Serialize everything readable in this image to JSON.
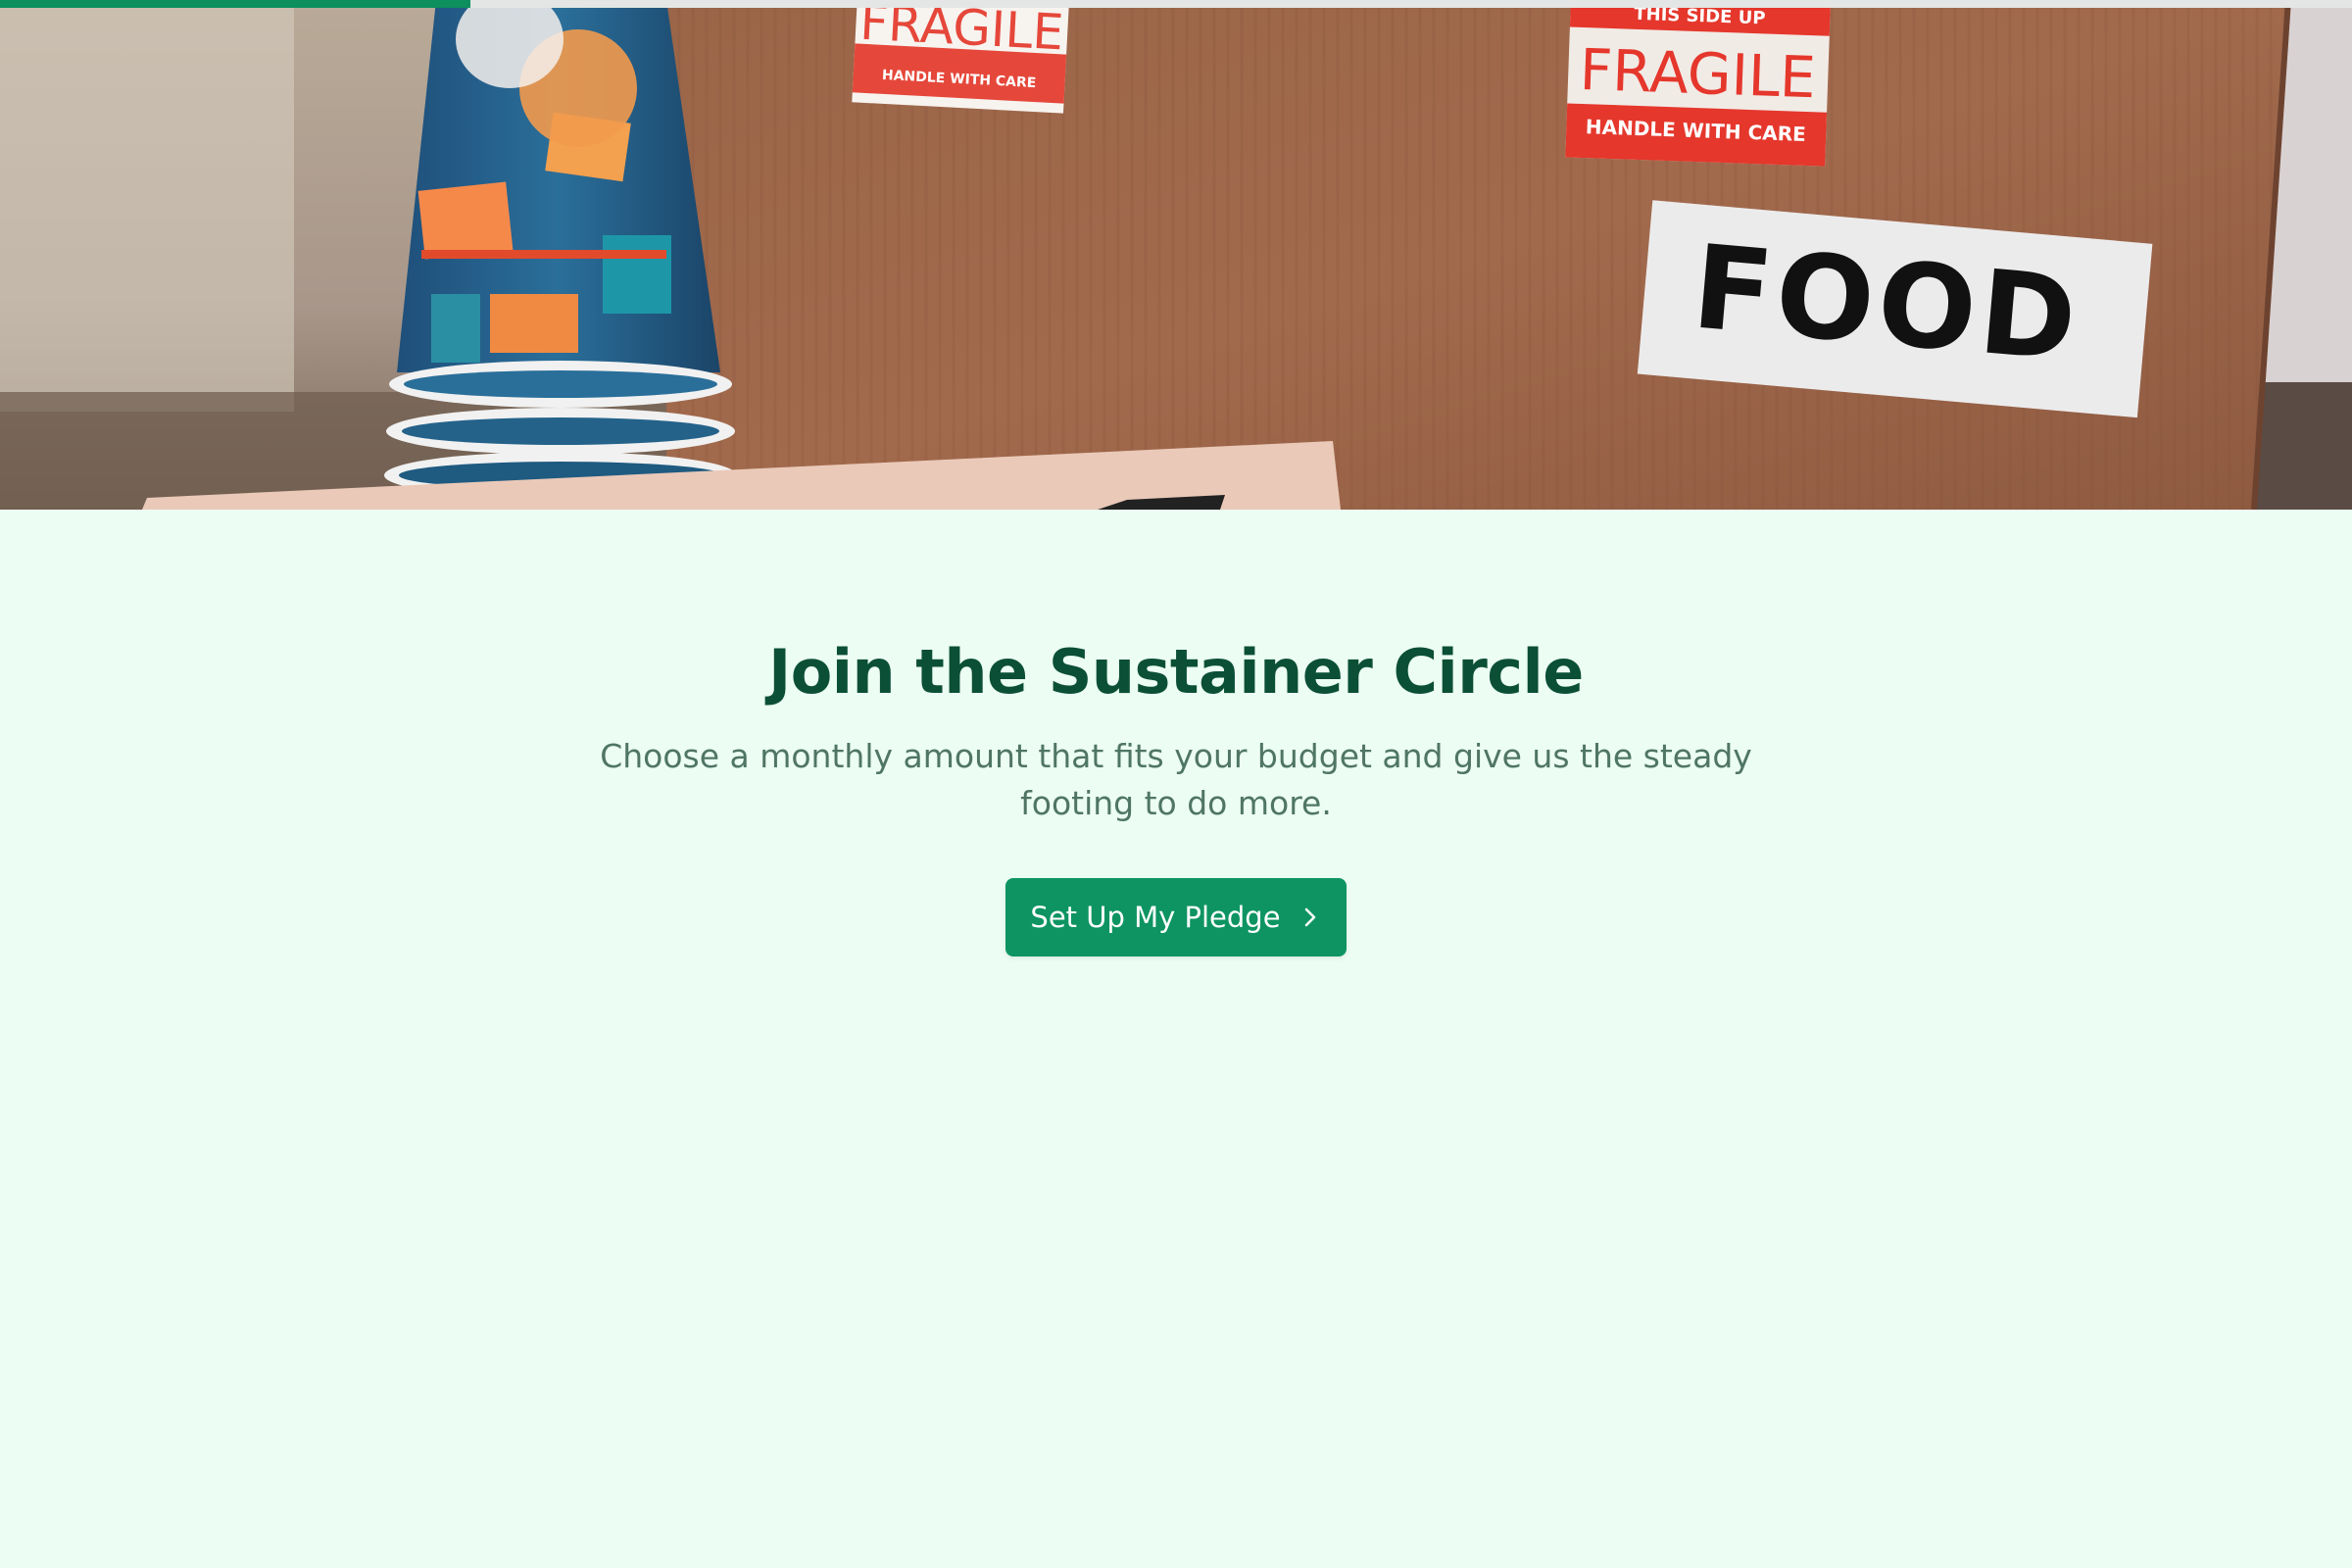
{
  "progress": {
    "value": 0.2
  },
  "hero": {
    "alt": "Donation box with fragile stickers",
    "sticker_fragile_left": "FRAGILE",
    "sticker_handle_left": "HANDLE WITH CARE",
    "sticker_this_side_up": "THIS SIDE UP",
    "sticker_fragile_right": "FRAGILE",
    "sticker_handle_right": "HANDLE WITH CARE",
    "label_food": "FOOD"
  },
  "main": {
    "title": "Join the Sustainer Circle",
    "subtitle": "Choose a monthly amount that fits your budget and give us the steady footing to do more.",
    "cta_label": "Set Up My Pledge",
    "cta_icon": "chevron-right-icon"
  },
  "colors": {
    "background": "#ecfdf3",
    "accent": "#0d9462",
    "title": "#0b4f37",
    "subtitle": "#4f7566"
  }
}
